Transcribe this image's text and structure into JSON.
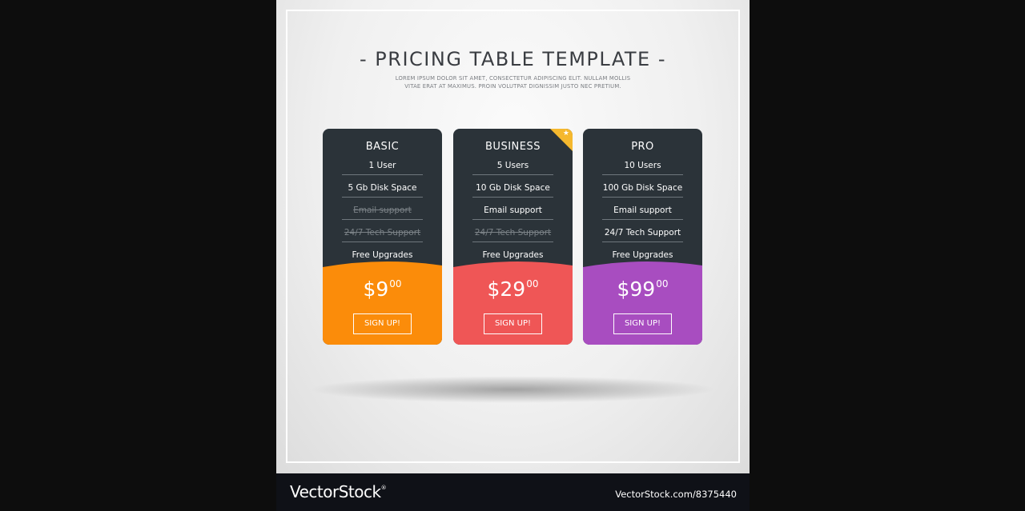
{
  "header": {
    "title": "- PRICING TABLE TEMPLATE -",
    "subtitle_line1": "LOREM IPSUM DOLOR SIT AMET, CONSECTETUR ADIPISCING ELIT. NULLAM MOLLIS",
    "subtitle_line2": "VITAE ERAT AT MAXIMUS. PROIN VOLUTPAT DIGNISSIM JUSTO NEC PRETIUM."
  },
  "colors": {
    "card_dark": "#2b3339",
    "basic": "#fb8c0a",
    "business": "#ef5656",
    "pro": "#a84dc0",
    "ribbon": "#f5b82e"
  },
  "plans": [
    {
      "name": "BASIC",
      "features": [
        {
          "label": "1 User",
          "included": true
        },
        {
          "label": "5 Gb Disk Space",
          "included": true
        },
        {
          "label": "Email support",
          "included": false
        },
        {
          "label": "24/7 Tech Support",
          "included": false
        },
        {
          "label": "Free Upgrades",
          "included": true
        }
      ],
      "price_main": "$9",
      "price_cents": "00",
      "button": "SIGN UP!"
    },
    {
      "name": "BUSINESS",
      "featured": true,
      "ribbon_icon": "star-icon",
      "ribbon_glyph": "★",
      "features": [
        {
          "label": "5 Users",
          "included": true
        },
        {
          "label": "10 Gb Disk Space",
          "included": true
        },
        {
          "label": "Email support",
          "included": true
        },
        {
          "label": "24/7 Tech Support",
          "included": false
        },
        {
          "label": "Free Upgrades",
          "included": true
        }
      ],
      "price_main": "$29",
      "price_cents": "00",
      "button": "SIGN UP!"
    },
    {
      "name": "PRO",
      "features": [
        {
          "label": "10 Users",
          "included": true
        },
        {
          "label": "100 Gb Disk Space",
          "included": true
        },
        {
          "label": "Email support",
          "included": true
        },
        {
          "label": "24/7 Tech Support",
          "included": true
        },
        {
          "label": "Free Upgrades",
          "included": true
        }
      ],
      "price_main": "$99",
      "price_cents": "00",
      "button": "SIGN UP!"
    }
  ],
  "footer": {
    "brand": "VectorStock",
    "brand_mark": "®",
    "url": "VectorStock.com/8375440"
  }
}
